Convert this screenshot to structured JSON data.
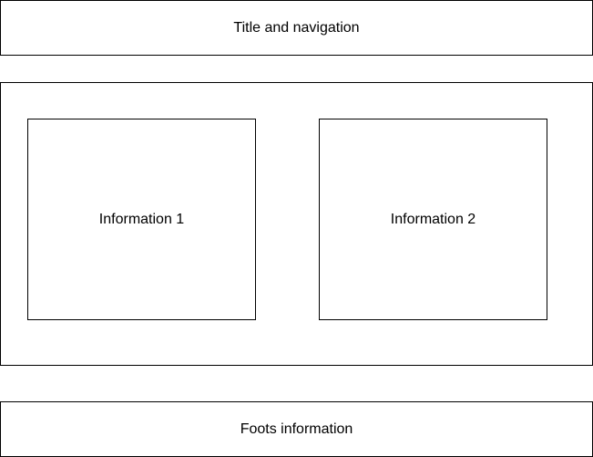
{
  "header": {
    "label": "Title and navigation"
  },
  "main": {
    "info1": {
      "label": "Information 1"
    },
    "info2": {
      "label": "Information 2"
    }
  },
  "footer": {
    "label": "Foots information"
  }
}
